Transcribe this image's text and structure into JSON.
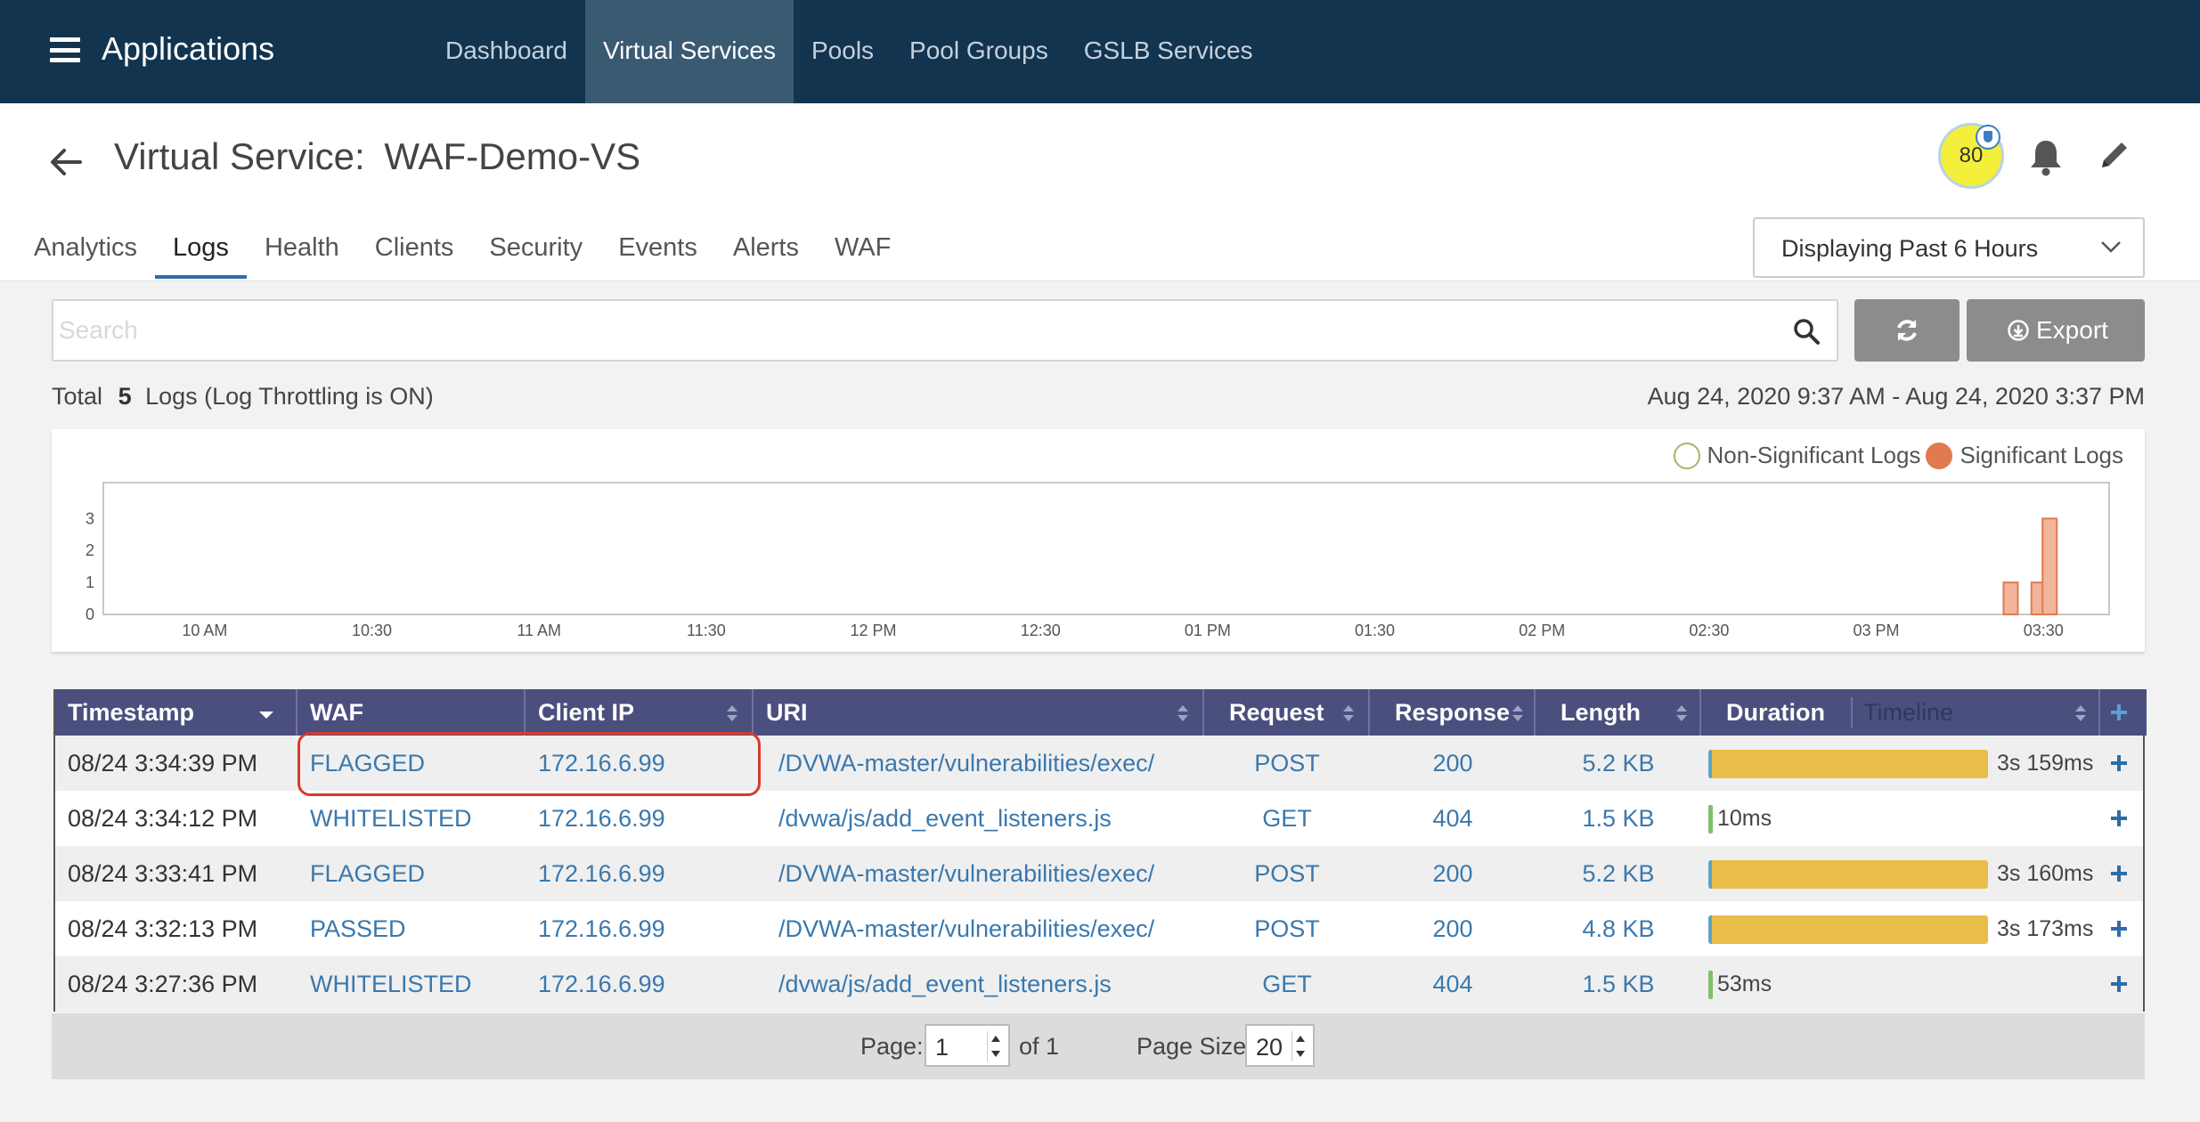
{
  "app": {
    "title": "Applications",
    "menu_icon": "hamburger-icon"
  },
  "nav": {
    "items": [
      "Dashboard",
      "Virtual Services",
      "Pools",
      "Pool Groups",
      "GSLB Services"
    ],
    "active": "Virtual Services"
  },
  "header": {
    "title_prefix": "Virtual Service:",
    "title_name": "WAF-Demo-VS",
    "health_score": "80",
    "health_color": "#f4ef3a",
    "tabs": [
      "Analytics",
      "Logs",
      "Health",
      "Clients",
      "Security",
      "Events",
      "Alerts",
      "WAF"
    ],
    "active_tab": "Logs",
    "time_range_label": "Displaying Past 6 Hours"
  },
  "toolbar": {
    "search_placeholder": "Search",
    "export_label": "Export"
  },
  "summary": {
    "total_prefix": "Total",
    "total_count": "5",
    "total_suffix": "Logs (Log Throttling is ON)",
    "date_range": "Aug 24, 2020 9:37 AM - Aug 24, 2020 3:37 PM"
  },
  "chart_data": {
    "type": "bar",
    "legend": [
      "Non-Significant Logs",
      "Significant Logs"
    ],
    "legend_placement": "top-right",
    "x_tick_labels": [
      "10 AM",
      "10:30",
      "11 AM",
      "11:30",
      "12 PM",
      "12:30",
      "01 PM",
      "01:30",
      "02 PM",
      "02:30",
      "03 PM",
      "03:30"
    ],
    "y_tick_labels": [
      "0",
      "1",
      "2",
      "3"
    ],
    "ylim": [
      0,
      4
    ],
    "series": [
      {
        "name": "Significant Logs",
        "color": "#e07a50",
        "x": [
          "03:27",
          "03:32",
          "03:34"
        ],
        "values": [
          1,
          1,
          3
        ]
      }
    ]
  },
  "table": {
    "columns": [
      "Timestamp",
      "WAF",
      "Client IP",
      "URI",
      "Request",
      "Response",
      "Length",
      "Duration",
      "Timeline"
    ],
    "rows": [
      {
        "timestamp": "08/24 3:34:39 PM",
        "waf": "FLAGGED",
        "client_ip": "172.16.6.99",
        "uri": "/DVWA-master/vulnerabilities/exec/",
        "request": "POST",
        "response": "200",
        "length": "5.2 KB",
        "duration": "3s 159ms",
        "duration_fraction": 1.0
      },
      {
        "timestamp": "08/24 3:34:12 PM",
        "waf": "WHITELISTED",
        "client_ip": "172.16.6.99",
        "uri": "/dvwa/js/add_event_listeners.js",
        "request": "GET",
        "response": "404",
        "length": "1.5 KB",
        "duration": "10ms",
        "duration_fraction": 0.0
      },
      {
        "timestamp": "08/24 3:33:41 PM",
        "waf": "FLAGGED",
        "client_ip": "172.16.6.99",
        "uri": "/DVWA-master/vulnerabilities/exec/",
        "request": "POST",
        "response": "200",
        "length": "5.2 KB",
        "duration": "3s 160ms",
        "duration_fraction": 1.0
      },
      {
        "timestamp": "08/24 3:32:13 PM",
        "waf": "PASSED",
        "client_ip": "172.16.6.99",
        "uri": "/DVWA-master/vulnerabilities/exec/",
        "request": "POST",
        "response": "200",
        "length": "4.8 KB",
        "duration": "3s 173ms",
        "duration_fraction": 1.0
      },
      {
        "timestamp": "08/24 3:27:36 PM",
        "waf": "WHITELISTED",
        "client_ip": "172.16.6.99",
        "uri": "/dvwa/js/add_event_listeners.js",
        "request": "GET",
        "response": "404",
        "length": "1.5 KB",
        "duration": "53ms",
        "duration_fraction": 0.0
      }
    ]
  },
  "pager": {
    "page_label": "Page:",
    "page_value": "1",
    "of_label": "of 1",
    "size_label": "Page Size:",
    "size_value": "20"
  }
}
